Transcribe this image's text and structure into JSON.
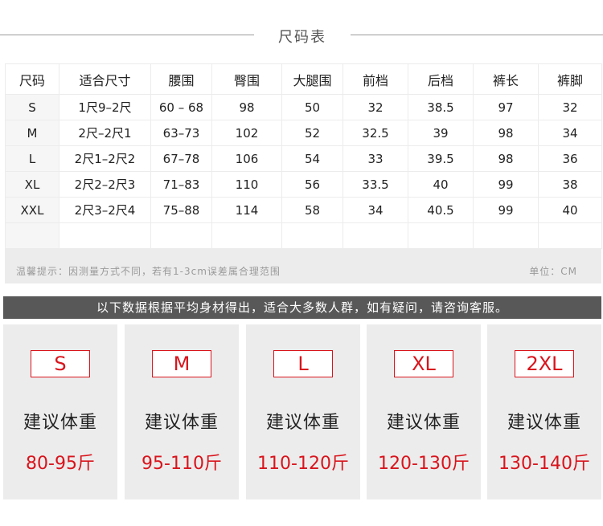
{
  "title": "尺码表",
  "table": {
    "headers": [
      "尺码",
      "适合尺寸",
      "腰围",
      "臀围",
      "大腿围",
      "前档",
      "后档",
      "裤长",
      "裤脚"
    ],
    "rows": [
      [
        "S",
        "1尺9–2尺",
        "60 – 68",
        "98",
        "50",
        "32",
        "38.5",
        "97",
        "32"
      ],
      [
        "M",
        "2尺–2尺1",
        "63–73",
        "102",
        "52",
        "32.5",
        "39",
        "98",
        "34"
      ],
      [
        "L",
        "2尺1–2尺2",
        "67–78",
        "106",
        "54",
        "33",
        "39.5",
        "98",
        "36"
      ],
      [
        "XL",
        "2尺2–2尺3",
        "71–83",
        "110",
        "56",
        "33.5",
        "40",
        "99",
        "38"
      ],
      [
        "XXL",
        "2尺3–2尺4",
        "75–88",
        "114",
        "58",
        "34",
        "40.5",
        "99",
        "40"
      ],
      [
        "",
        "",
        "",
        "",
        "",
        "",
        "",
        "",
        ""
      ]
    ],
    "note": "温馨提示：因测量方式不同，若有1-3cm误差属合理范围",
    "unit": "单位：CM"
  },
  "banner": "以下数据根据平均身材得出，适合大多数人群，如有疑问，请咨询客服。",
  "cards": [
    {
      "size": "S",
      "label": "建议体重",
      "weight": "80-95斤"
    },
    {
      "size": "M",
      "label": "建议体重",
      "weight": "95-110斤"
    },
    {
      "size": "L",
      "label": "建议体重",
      "weight": "110-120斤"
    },
    {
      "size": "XL",
      "label": "建议体重",
      "weight": "120-130斤"
    },
    {
      "size": "2XL",
      "label": "建议体重",
      "weight": "130-140斤"
    }
  ],
  "colors": {
    "accent_red": "#d9141c",
    "banner_gray": "#585858",
    "panel_gray": "#ececec"
  }
}
